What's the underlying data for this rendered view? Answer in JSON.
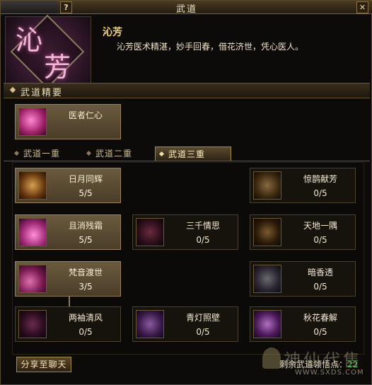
{
  "window": {
    "title": "武道",
    "help_label": "?",
    "close_label": "✕"
  },
  "character": {
    "emblem_text": [
      "沁",
      "芳"
    ],
    "name": "沁芳",
    "description": "沁芳医术精湛，妙手回春，借花济世，凭心医人。"
  },
  "essentials": {
    "label": "武道精要",
    "skill": {
      "name": "医者仁心",
      "icon": "healer-heart-icon"
    }
  },
  "tabs": [
    {
      "label": "武道一重",
      "selected": false
    },
    {
      "label": "武道二重",
      "selected": false
    },
    {
      "label": "武道三重",
      "selected": true
    }
  ],
  "skills": [
    {
      "name": "日月同辉",
      "level": "5/5",
      "active": true,
      "icon": "sun-moon-icon"
    },
    {
      "name": "惊鹊献芳",
      "level": "0/5",
      "active": false,
      "icon": "magpie-icon"
    },
    {
      "name": "且消残霜",
      "level": "5/5",
      "active": true,
      "icon": "frost-icon"
    },
    {
      "name": "三千情思",
      "level": "0/5",
      "active": false,
      "icon": "thoughts-icon"
    },
    {
      "name": "天地一隅",
      "level": "0/5",
      "active": false,
      "icon": "corner-icon"
    },
    {
      "name": "梵音渡世",
      "level": "3/5",
      "active": true,
      "icon": "chant-icon"
    },
    {
      "name": "暗香透",
      "level": "0/5",
      "active": false,
      "icon": "fragrance-icon"
    },
    {
      "name": "两袖清风",
      "level": "0/5",
      "active": false,
      "icon": "breeze-icon"
    },
    {
      "name": "青灯照壁",
      "level": "0/5",
      "active": false,
      "icon": "lamp-icon"
    },
    {
      "name": "秋花春解",
      "level": "0/5",
      "active": false,
      "icon": "flower-icon"
    }
  ],
  "footer": {
    "share_label": "分享至聊天",
    "points_label": "剩余武道领悟点：",
    "points_value": "22"
  },
  "watermark": {
    "text": "神仙代售",
    "url": "WWW.SXDS.COM"
  }
}
